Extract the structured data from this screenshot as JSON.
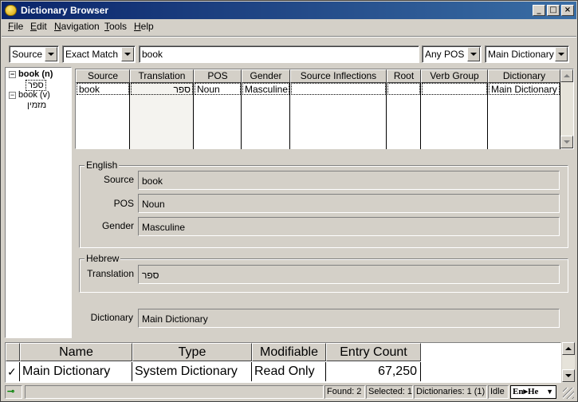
{
  "window": {
    "title": "Dictionary Browser"
  },
  "menu": [
    "File",
    "Edit",
    "Navigation",
    "Tools",
    "Help"
  ],
  "search": {
    "field_select": "Source",
    "match_select": "Exact Match",
    "query": "book",
    "pos_select": "Any POS",
    "dictionary_select": "Main Dictionary"
  },
  "tree": {
    "items": [
      {
        "label": "book (n)",
        "child": "ספר"
      },
      {
        "label": "book (v)",
        "child": "מזמין"
      }
    ]
  },
  "results": {
    "columns": [
      "Source",
      "Translation",
      "POS",
      "Gender",
      "Source Inflections",
      "Root",
      "Verb Group",
      "Dictionary"
    ],
    "rows": [
      [
        "book",
        "ספר",
        "Noun",
        "Masculine",
        "",
        "",
        "",
        "Main Dictionary"
      ]
    ]
  },
  "details": {
    "english_group": "English",
    "source_label": "Source",
    "source_value": "book",
    "pos_label": "POS",
    "pos_value": "Noun",
    "gender_label": "Gender",
    "gender_value": "Masculine",
    "hebrew_group": "Hebrew",
    "translation_label": "Translation",
    "translation_value": "ספר",
    "dictionary_label": "Dictionary",
    "dictionary_value": "Main Dictionary"
  },
  "dictionaries": {
    "columns": [
      "Name",
      "Type",
      "Modifiable",
      "Entry Count"
    ],
    "rows": [
      {
        "checked": "✓",
        "name": "Main Dictionary",
        "type": "System Dictionary",
        "modifiable": "Read Only",
        "count": "67,250"
      }
    ]
  },
  "status": {
    "found": "Found: 2",
    "selected": "Selected: 1",
    "dictionaries": "Dictionaries: 1 (1)",
    "state": "Idle",
    "language": "En▸He"
  }
}
